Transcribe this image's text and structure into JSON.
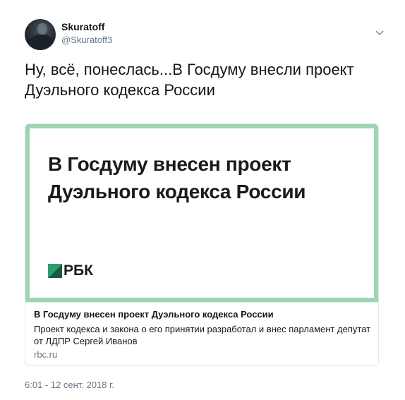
{
  "user": {
    "display_name": "Skuratoff",
    "handle": "@Skuratoff3",
    "avatar_icon": "user-avatar"
  },
  "menu": {
    "icon": "chevron-down-icon"
  },
  "tweet": {
    "text": "Ну, всё, понеслась...В Госдуму внесли проект Дуэльного кодекса России",
    "timestamp": "6:01 - 12 сент. 2018 г."
  },
  "card": {
    "image_headline": "В Госдуму внесен проект Дуэльного кодекса России",
    "logo_text": "РБК",
    "logo_icon": "rbc-logo-icon",
    "title": "В Госдуму внесен проект Дуэльного кодекса России",
    "description": "Проект кодекса и закона о его принятии разработал и внес парламент депутат от ЛДПР Сергей Иванов",
    "domain": "rbc.ru"
  },
  "colors": {
    "card_frame": "#9fd4b3",
    "muted_text": "#657786",
    "rbc_green": "#2e9e6e",
    "rbc_dark": "#1b5a43"
  }
}
